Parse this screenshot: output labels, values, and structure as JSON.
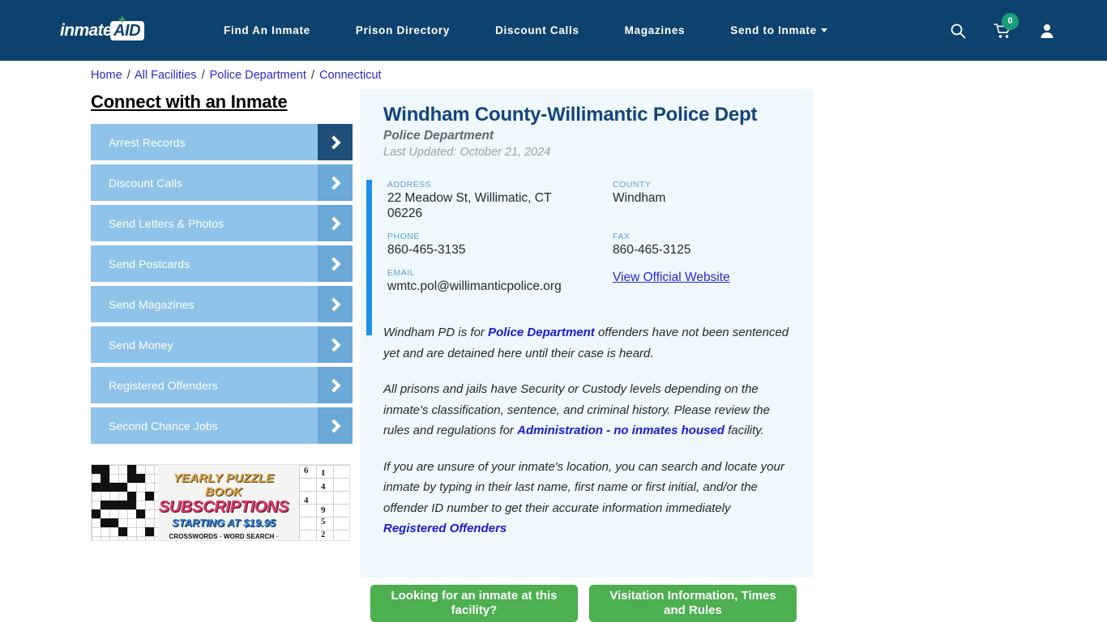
{
  "header": {
    "logo_word": "inmate",
    "logo_aid": "AID",
    "logo_plus": "+",
    "nav": [
      {
        "label": "Find An Inmate"
      },
      {
        "label": "Prison Directory"
      },
      {
        "label": "Discount Calls"
      },
      {
        "label": "Magazines"
      },
      {
        "label": "Send to Inmate"
      }
    ],
    "search_icon": "search-icon",
    "cart_icon": "cart-icon",
    "cart_count": "0",
    "account_icon": "user-icon",
    "bg_color": "#0d426e",
    "badge_color": "#1a9e78"
  },
  "breadcrumb": {
    "items": [
      "Home",
      "All Facilities",
      "Police Department",
      "Connecticut"
    ],
    "separator": "/"
  },
  "sidebar": {
    "title": "Connect with an Inmate",
    "items": [
      {
        "label": "Arrest Records",
        "active": true
      },
      {
        "label": "Discount Calls",
        "active": false
      },
      {
        "label": "Send Letters & Photos",
        "active": false
      },
      {
        "label": "Send Postcards",
        "active": false
      },
      {
        "label": "Send Magazines",
        "active": false
      },
      {
        "label": "Send Money",
        "active": false
      },
      {
        "label": "Registered Offenders",
        "active": false
      },
      {
        "label": "Second Chance Jobs",
        "active": false
      }
    ],
    "button_color": "#8fc3e9",
    "arrow_color": "#6aa9d8",
    "active_arrow_color": "#1f4f79"
  },
  "ad": {
    "line1": "YEARLY PUZZLE BOOK",
    "line2": "SUBSCRIPTIONS",
    "line3": "STARTING AT $19.95",
    "line4": "CROSSWORDS · WORD SEARCH · SUDOKU · BRAIN TEASERS",
    "sudoku_digits": [
      "6",
      "1",
      "4",
      "4",
      "9",
      "5",
      "2"
    ]
  },
  "facility": {
    "name": "Windham County-Willimantic Police Dept",
    "type": "Police Department",
    "last_updated": "Last Updated: October 21, 2024",
    "fields": {
      "address_label": "ADDRESS",
      "address_value": "22 Meadow St, Willimatic, CT 06226",
      "county_label": "COUNTY",
      "county_value": "Windham",
      "phone_label": "PHONE",
      "phone_value": "860-465-3135",
      "fax_label": "FAX",
      "fax_value": "860-465-3125",
      "email_label": "EMAIL",
      "email_value": "wmtc.pol@willimanticpolice.org",
      "website_link": "View Official Website"
    },
    "accent_color": "#1e90e8",
    "panel_color": "#eef8fd"
  },
  "description": {
    "p1_a": "Windham PD is for ",
    "p1_hl": "Police Department",
    "p1_b": " offenders have not been sentenced yet and are detained here until their case is heard.",
    "p2_a": "All prisons and jails have Security or Custody levels depending on the inmate's classification, sentence, and criminal history. Please review the rules and regulations for ",
    "p2_hl": "Administration - no inmates housed",
    "p2_b": " facility.",
    "p3_a": "If you are unsure of your inmate's location, you can search and locate your inmate by typing in their last name, first name or first initial, and/or the offender ID number to get their accurate information immediately ",
    "p3_hl": "Registered Offenders"
  },
  "cta": {
    "buttons": [
      {
        "label": "Looking for an inmate at this facility?"
      },
      {
        "label": "Visitation Information, Times and Rules"
      }
    ],
    "color": "#4caf50"
  }
}
